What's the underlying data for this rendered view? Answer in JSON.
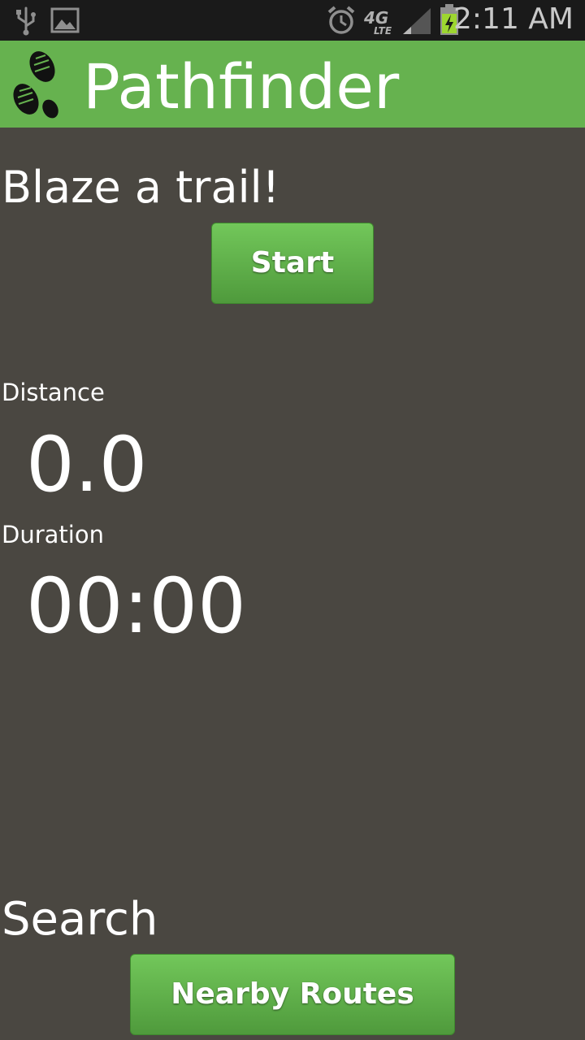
{
  "status_bar": {
    "time": "2:11 AM",
    "network": "4G LTE",
    "icons": [
      "usb-icon",
      "gallery-icon",
      "alarm-icon",
      "lte-icon",
      "signal-icon",
      "battery-charging-icon"
    ]
  },
  "action_bar": {
    "title": "Pathfinder",
    "logo_icon": "footprints-icon",
    "color": "#66b24f"
  },
  "tracker": {
    "headline": "Blaze a trail!",
    "start_label": "Start",
    "distance_label": "Distance",
    "distance_value": "0.0",
    "duration_label": "Duration",
    "duration_value": "00:00"
  },
  "search": {
    "headline": "Search",
    "nearby_label": "Nearby Routes"
  },
  "colors": {
    "background": "#4a4741",
    "button_top": "#72c75a",
    "button_bottom": "#4f9a3c",
    "status_bar": "#1a1a1a"
  }
}
